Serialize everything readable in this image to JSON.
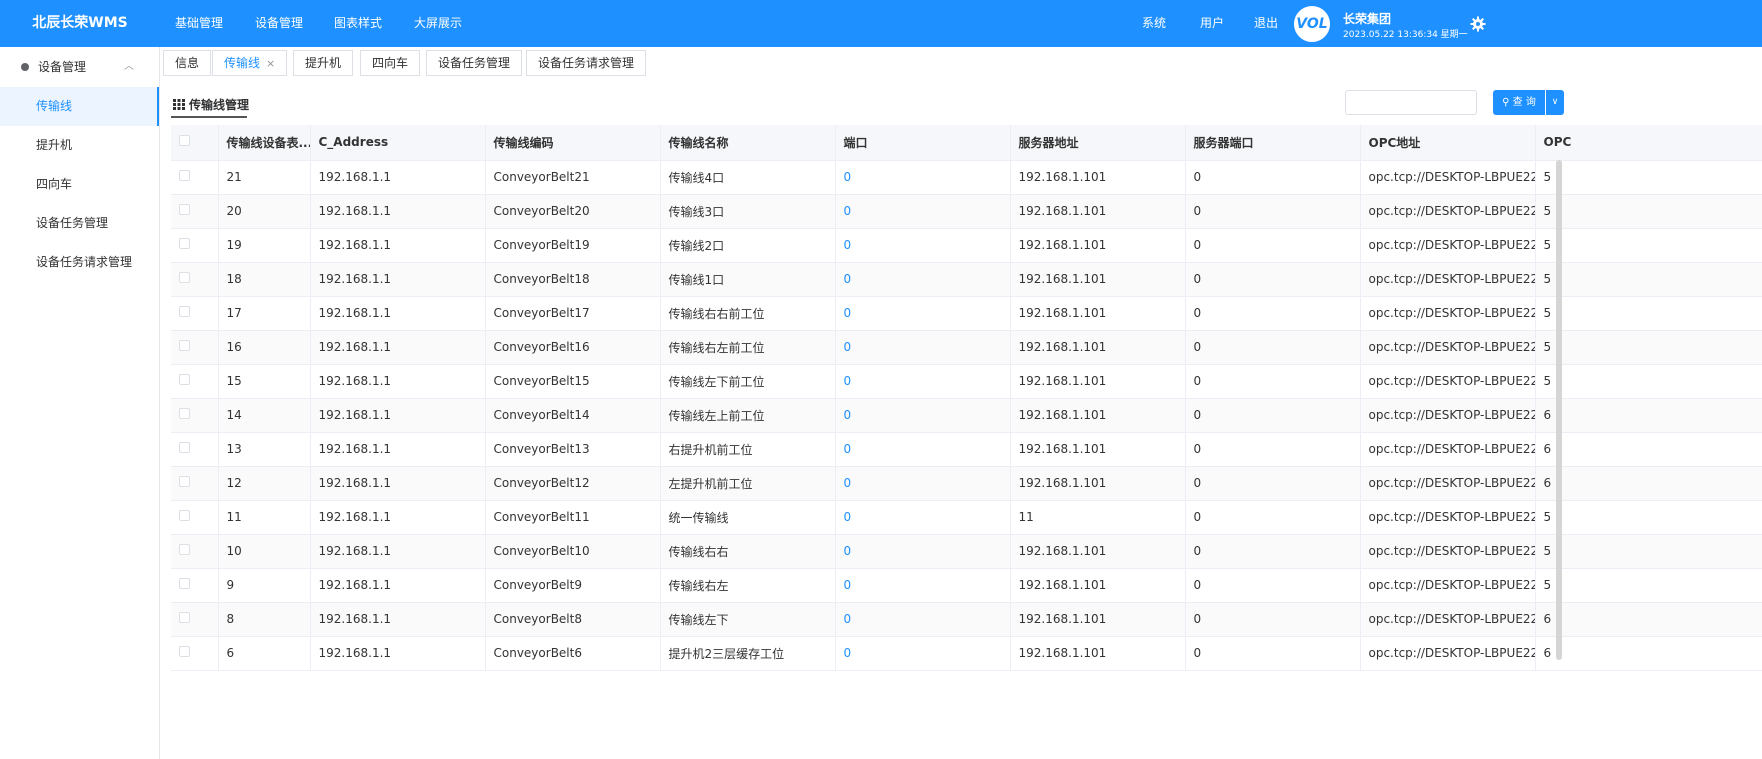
{
  "header": {
    "brand": "北辰长荣WMS",
    "nav": [
      "基础管理",
      "设备管理",
      "图表样式",
      "大屏展示"
    ],
    "right": [
      "系统",
      "用户",
      "退出"
    ],
    "logo_text": "VOL",
    "company": "长荣集团",
    "datetime": "2023.05.22 13:36:34 星期一"
  },
  "sidebar": {
    "group": "设备管理",
    "items": [
      "传输线",
      "提升机",
      "四向车",
      "设备任务管理",
      "设备任务请求管理"
    ]
  },
  "tabs": [
    {
      "label": "信息"
    },
    {
      "label": "传输线",
      "close": "×"
    },
    {
      "label": "提升机"
    },
    {
      "label": "四向车"
    },
    {
      "label": "设备任务管理"
    },
    {
      "label": "设备任务请求管理"
    }
  ],
  "panel": {
    "title": "传输线管理",
    "search_placeholder": "",
    "query_label": "查 询"
  },
  "table": {
    "columns": [
      "传输线设备表...",
      "C_Address",
      "传输线编码",
      "传输线名称",
      "端口",
      "服务器地址",
      "服务器端口",
      "OPC地址",
      "OPC"
    ],
    "rows": [
      [
        "21",
        "192.168.1.1",
        "ConveyorBelt21",
        "传输线4口",
        "0",
        "192.168.1.101",
        "0",
        "opc.tcp://DESKTOP-LBPUE22",
        "5"
      ],
      [
        "20",
        "192.168.1.1",
        "ConveyorBelt20",
        "传输线3口",
        "0",
        "192.168.1.101",
        "0",
        "opc.tcp://DESKTOP-LBPUE22",
        "5"
      ],
      [
        "19",
        "192.168.1.1",
        "ConveyorBelt19",
        "传输线2口",
        "0",
        "192.168.1.101",
        "0",
        "opc.tcp://DESKTOP-LBPUE22",
        "5"
      ],
      [
        "18",
        "192.168.1.1",
        "ConveyorBelt18",
        "传输线1口",
        "0",
        "192.168.1.101",
        "0",
        "opc.tcp://DESKTOP-LBPUE22",
        "5"
      ],
      [
        "17",
        "192.168.1.1",
        "ConveyorBelt17",
        "传输线右右前工位",
        "0",
        "192.168.1.101",
        "0",
        "opc.tcp://DESKTOP-LBPUE22",
        "5"
      ],
      [
        "16",
        "192.168.1.1",
        "ConveyorBelt16",
        "传输线右左前工位",
        "0",
        "192.168.1.101",
        "0",
        "opc.tcp://DESKTOP-LBPUE22",
        "5"
      ],
      [
        "15",
        "192.168.1.1",
        "ConveyorBelt15",
        "传输线左下前工位",
        "0",
        "192.168.1.101",
        "0",
        "opc.tcp://DESKTOP-LBPUE22",
        "5"
      ],
      [
        "14",
        "192.168.1.1",
        "ConveyorBelt14",
        "传输线左上前工位",
        "0",
        "192.168.1.101",
        "0",
        "opc.tcp://DESKTOP-LBPUE22",
        "6"
      ],
      [
        "13",
        "192.168.1.1",
        "ConveyorBelt13",
        "右提升机前工位",
        "0",
        "192.168.1.101",
        "0",
        "opc.tcp://DESKTOP-LBPUE22",
        "6"
      ],
      [
        "12",
        "192.168.1.1",
        "ConveyorBelt12",
        "左提升机前工位",
        "0",
        "192.168.1.101",
        "0",
        "opc.tcp://DESKTOP-LBPUE22",
        "6"
      ],
      [
        "11",
        "192.168.1.1",
        "ConveyorBelt11",
        "统一传输线",
        "0",
        "11",
        "0",
        "opc.tcp://DESKTOP-LBPUE22",
        "5"
      ],
      [
        "10",
        "192.168.1.1",
        "ConveyorBelt10",
        "传输线右右",
        "0",
        "192.168.1.101",
        "0",
        "opc.tcp://DESKTOP-LBPUE22",
        "5"
      ],
      [
        "9",
        "192.168.1.1",
        "ConveyorBelt9",
        "传输线右左",
        "0",
        "192.168.1.101",
        "0",
        "opc.tcp://DESKTOP-LBPUE22",
        "5"
      ],
      [
        "8",
        "192.168.1.1",
        "ConveyorBelt8",
        "传输线左下",
        "0",
        "192.168.1.101",
        "0",
        "opc.tcp://DESKTOP-LBPUE22",
        "6"
      ],
      [
        "6",
        "192.168.1.1",
        "ConveyorBelt6",
        "提升机2三层缓存工位",
        "0",
        "192.168.1.101",
        "0",
        "opc.tcp://DESKTOP-LBPUE22",
        "6"
      ]
    ]
  },
  "colors": {
    "primary": "#1e90ff",
    "sidebar_active_bg": "#ecf5ff"
  }
}
